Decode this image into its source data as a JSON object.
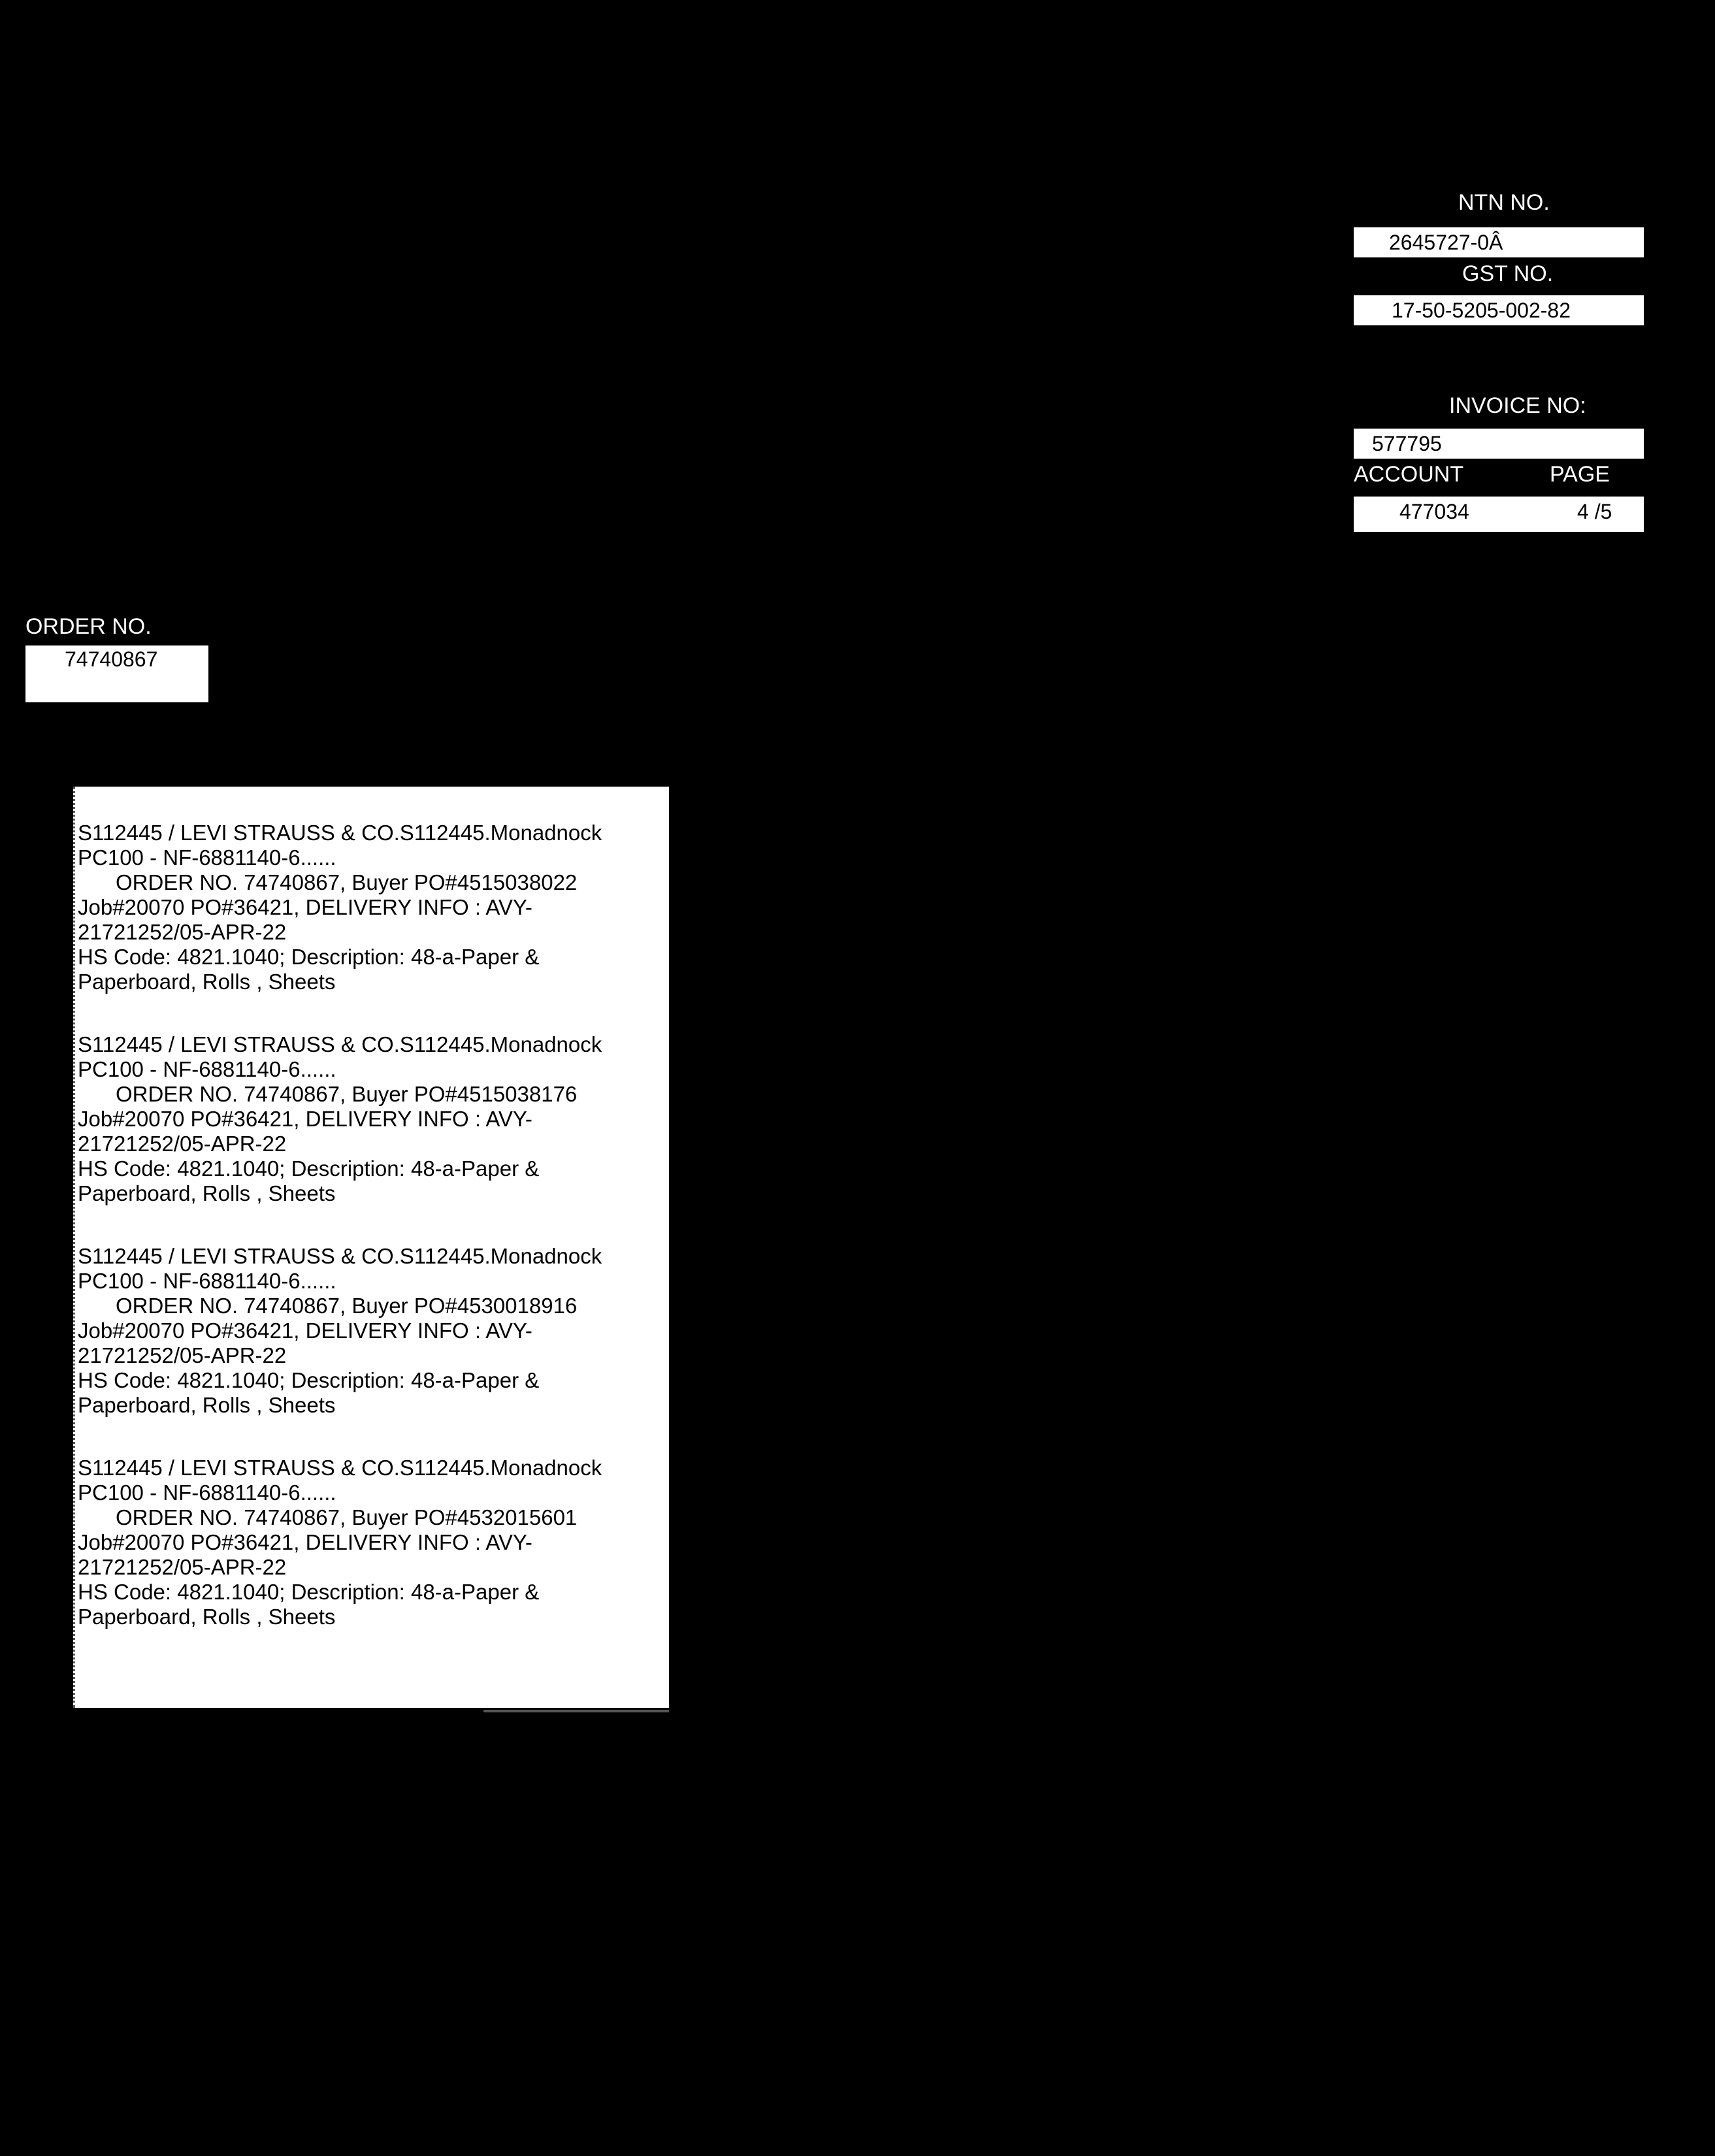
{
  "header": {
    "ntn_label": "NTN NO.",
    "ntn_value": "2645727-0Â",
    "gst_label": "GST NO.",
    "gst_value": "17-50-5205-002-82",
    "invoice_label": "INVOICE NO:",
    "invoice_value": "577795",
    "account_label": "ACCOUNT",
    "account_value": "477034",
    "page_label": "PAGE",
    "page_value": "4 /5"
  },
  "order": {
    "label": "ORDER NO.",
    "value": "74740867"
  },
  "items": [
    {
      "line1": "S112445 / LEVI STRAUSS & CO.S112445.Monadnock",
      "line2": "PC100 - NF-6881140-6......",
      "line3": "ORDER NO. 74740867, Buyer PO#4515038022",
      "line4": "Job#20070 PO#36421, DELIVERY INFO : AVY-",
      "line5": "21721252/05-APR-22",
      "line6": "HS Code: 4821.1040; Description: 48-a-Paper &",
      "line7": "Paperboard, Rolls , Sheets"
    },
    {
      "line1": "S112445 / LEVI STRAUSS & CO.S112445.Monadnock",
      "line2": "PC100 - NF-6881140-6......",
      "line3": "ORDER NO. 74740867, Buyer PO#4515038176",
      "line4": "Job#20070 PO#36421, DELIVERY INFO : AVY-",
      "line5": "21721252/05-APR-22",
      "line6": "HS Code: 4821.1040; Description: 48-a-Paper &",
      "line7": "Paperboard, Rolls , Sheets"
    },
    {
      "line1": "S112445 / LEVI STRAUSS & CO.S112445.Monadnock",
      "line2": "PC100 - NF-6881140-6......",
      "line3": "ORDER NO. 74740867, Buyer PO#4530018916",
      "line4": "Job#20070 PO#36421, DELIVERY INFO : AVY-",
      "line5": "21721252/05-APR-22",
      "line6": "HS Code: 4821.1040; Description: 48-a-Paper &",
      "line7": "Paperboard, Rolls , Sheets"
    },
    {
      "line1": "S112445 / LEVI STRAUSS & CO.S112445.Monadnock",
      "line2": "PC100 - NF-6881140-6......",
      "line3": "ORDER NO. 74740867, Buyer PO#4532015601",
      "line4": "Job#20070 PO#36421, DELIVERY INFO : AVY-",
      "line5": "21721252/05-APR-22",
      "line6": "HS Code: 4821.1040; Description: 48-a-Paper &",
      "line7": "Paperboard, Rolls , Sheets"
    }
  ]
}
